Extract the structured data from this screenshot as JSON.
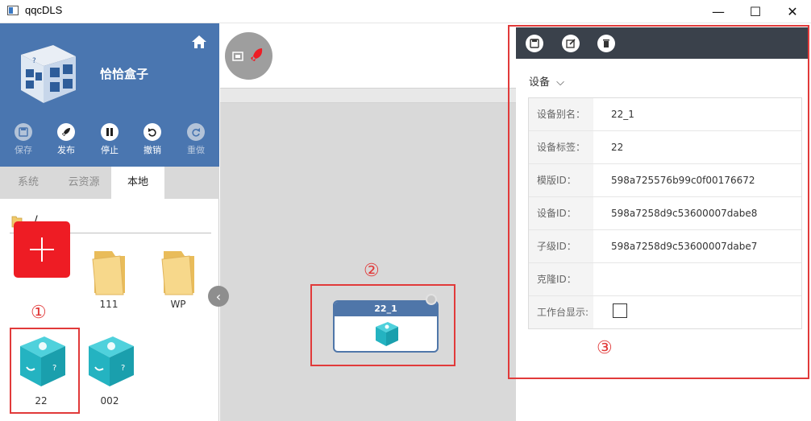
{
  "window": {
    "title": "qqcDLS",
    "minimize": "—",
    "maximize": "☐",
    "close": "✕"
  },
  "app": {
    "name": "恰恰盒子"
  },
  "toolbar": [
    {
      "label": "保存",
      "icon": "save-icon",
      "enabled": false
    },
    {
      "label": "发布",
      "icon": "rocket-icon",
      "enabled": true
    },
    {
      "label": "停止",
      "icon": "pause-icon",
      "enabled": true
    },
    {
      "label": "撤销",
      "icon": "undo-icon",
      "enabled": true
    },
    {
      "label": "重做",
      "icon": "redo-icon",
      "enabled": false
    }
  ],
  "tabs": [
    {
      "label": "系统",
      "active": false
    },
    {
      "label": "云资源",
      "active": false
    },
    {
      "label": "本地",
      "active": true
    }
  ],
  "path": "/",
  "items": [
    {
      "label": "",
      "type": "add"
    },
    {
      "label": "111",
      "type": "folder"
    },
    {
      "label": "WP",
      "type": "folder"
    },
    {
      "label": "22",
      "type": "device"
    },
    {
      "label": "002",
      "type": "device"
    }
  ],
  "node": {
    "title": "22_1"
  },
  "markers": {
    "m1": "①",
    "m2": "②",
    "m3": "③"
  },
  "right": {
    "section": "设备",
    "props": [
      {
        "label": "设备别名：",
        "value": "22_1"
      },
      {
        "label": "设备标签：",
        "value": "22"
      },
      {
        "label": "模版ID：",
        "value": "598a725576b99c0f00176672"
      },
      {
        "label": "设备ID：",
        "value": "598a7258d9c53600007dabe8"
      },
      {
        "label": "子级ID：",
        "value": "598a7258d9c53600007dabe7"
      },
      {
        "label": "克隆ID：",
        "value": ""
      },
      {
        "label": "工作台显示:",
        "value": "",
        "checked": false
      }
    ]
  },
  "colors": {
    "header_blue": "#4a76b0",
    "accent_red": "#ee1c24",
    "highlight_red": "#e13a3a",
    "panel_dark": "#3a414b"
  }
}
